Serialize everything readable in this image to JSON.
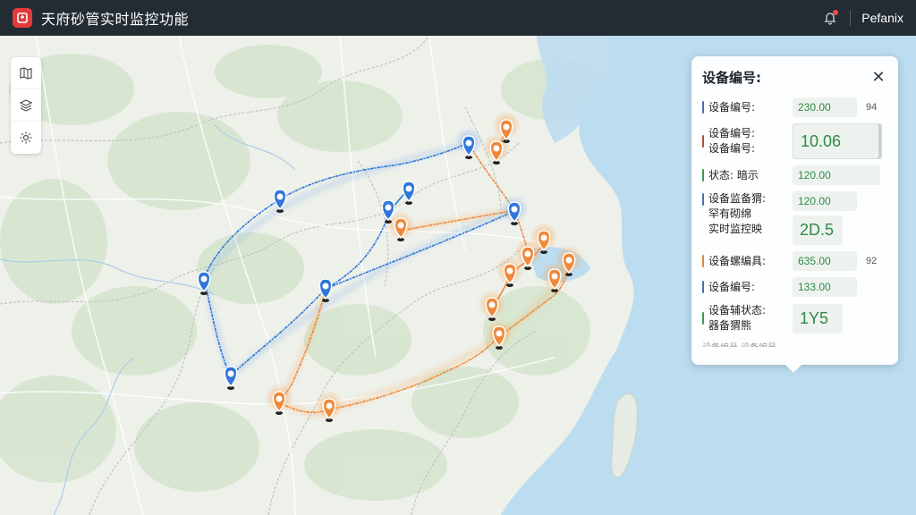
{
  "header": {
    "title": "天府砂管实时监控功能",
    "user": "Pefanix",
    "logo_icon": "map-logo-icon",
    "bell_icon": "bell-icon"
  },
  "toolbar": {
    "items": [
      {
        "name": "map-view-icon"
      },
      {
        "name": "layers-icon"
      },
      {
        "name": "gear-icon"
      }
    ]
  },
  "panel": {
    "title": "设备编号:",
    "close_icon": "close-icon",
    "rows": [
      {
        "label": "设备编号:",
        "value": "230.00",
        "extra": "94",
        "color": "#4a6fb5"
      },
      {
        "label": "设备编号:\n设备编号:",
        "value": "10.06",
        "extra": "",
        "color": "#c04a3a"
      },
      {
        "label": "状态: 暗示",
        "value": "120.00",
        "extra": "",
        "color": "#3a9a55"
      },
      {
        "label": "设备监备猬:\n罕有砌绵\n实时监控映",
        "value": "120.00",
        "value2": "2D.5",
        "extra": "",
        "color": "#4a6fb5"
      },
      {
        "label": "设备螺编具:",
        "value": "635.00",
        "extra": "92",
        "color": "#e08a3a"
      },
      {
        "label": "设备编号:",
        "value": "133.00",
        "extra": "",
        "color": "#4a6fb5"
      },
      {
        "label": "设备辅状态:\n器备猬熊",
        "value": "1Y5",
        "extra": "",
        "color": "#3a9a55"
      }
    ],
    "footer": "设备编号 设备编号"
  },
  "colors": {
    "blue_route": "#2f77d9",
    "orange_route": "#f0883a",
    "sea": "#bcdcf0",
    "land": "#eef0ea"
  }
}
